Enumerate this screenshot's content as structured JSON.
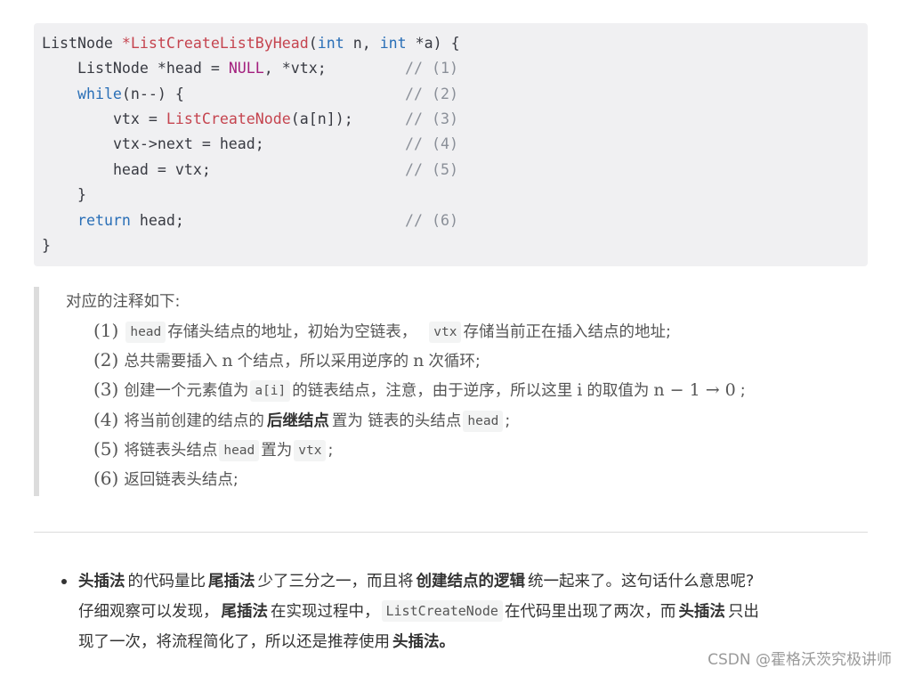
{
  "code": {
    "line1": {
      "type": "ListNode ",
      "star": "*",
      "fn": "ListCreateListByHead",
      "open": "(",
      "kw1": "int",
      "p1": " n, ",
      "kw2": "int",
      "p2": " *a) {"
    },
    "line2": {
      "pre": "ListNode *head = ",
      "null": "NULL",
      "post": ", *vtx;",
      "comment": "// (1)"
    },
    "line3": {
      "kw": "while",
      "post": "(n--) {",
      "comment": "// (2)"
    },
    "line4": {
      "pre": "vtx = ",
      "fn": "ListCreateNode",
      "post": "(a[n]);",
      "comment": "// (3)"
    },
    "line5": {
      "text": "vtx->next = head;",
      "comment": "// (4)"
    },
    "line6": {
      "text": "head = vtx;",
      "comment": "// (5)"
    },
    "line7": {
      "text": "}"
    },
    "line8": {
      "kw": "return",
      "post": " head;",
      "comment": "// (6)"
    },
    "line9": {
      "text": "}"
    }
  },
  "notes": {
    "intro": "对应的注释如下:",
    "n1": {
      "num": "(1)",
      "code1": "head",
      "t1": "存储头结点的地址，初始为空链表，",
      "code2": "vtx",
      "t2": "存储当前正在插入结点的地址;"
    },
    "n2": {
      "num": "(2)",
      "t1": "总共需要插入",
      "math": "n",
      "t2": "个结点，所以采用逆序的",
      "math2": "n",
      "t3": "次循环;"
    },
    "n3": {
      "num": "(3)",
      "t1": "创建一个元素值为",
      "code1": "a[i]",
      "t2": "的链表结点，注意，由于逆序，所以这里",
      "math": "i",
      "t3": "的取值为",
      "math2": "n − 1 → 0",
      "t4": ";"
    },
    "n4": {
      "num": "(4)",
      "t1": "将当前创建的结点的",
      "bold": "后继结点",
      "t2": "置为 链表的头结点",
      "code1": "head",
      "t3": ";"
    },
    "n5": {
      "num": "(5)",
      "t1": "将链表头结点",
      "code1": "head",
      "t2": "置为",
      "code2": "vtx",
      "t3": ";"
    },
    "n6": {
      "num": "(6)",
      "t1": "返回链表头结点;"
    }
  },
  "bullet": {
    "l1": {
      "b1": "头插法",
      "t1": "的代码量比",
      "b2": "尾插法",
      "t2": "少了三分之一，而且将",
      "b3": "创建结点的逻辑",
      "t3": "统一起来了。这句话什么意思呢?"
    },
    "l2": {
      "t1": "仔细观察可以发现，",
      "b1": "尾插法",
      "t2": "在实现过程中，",
      "code1": "ListCreateNode",
      "t3": "在代码里出现了两次，而",
      "b2": "头插法",
      "t4": "只出"
    },
    "l3": {
      "t1": "现了一次，将流程简化了，所以还是推荐使用",
      "b1": "头插法。"
    }
  },
  "watermark": "CSDN @霍格沃茨究极讲师"
}
